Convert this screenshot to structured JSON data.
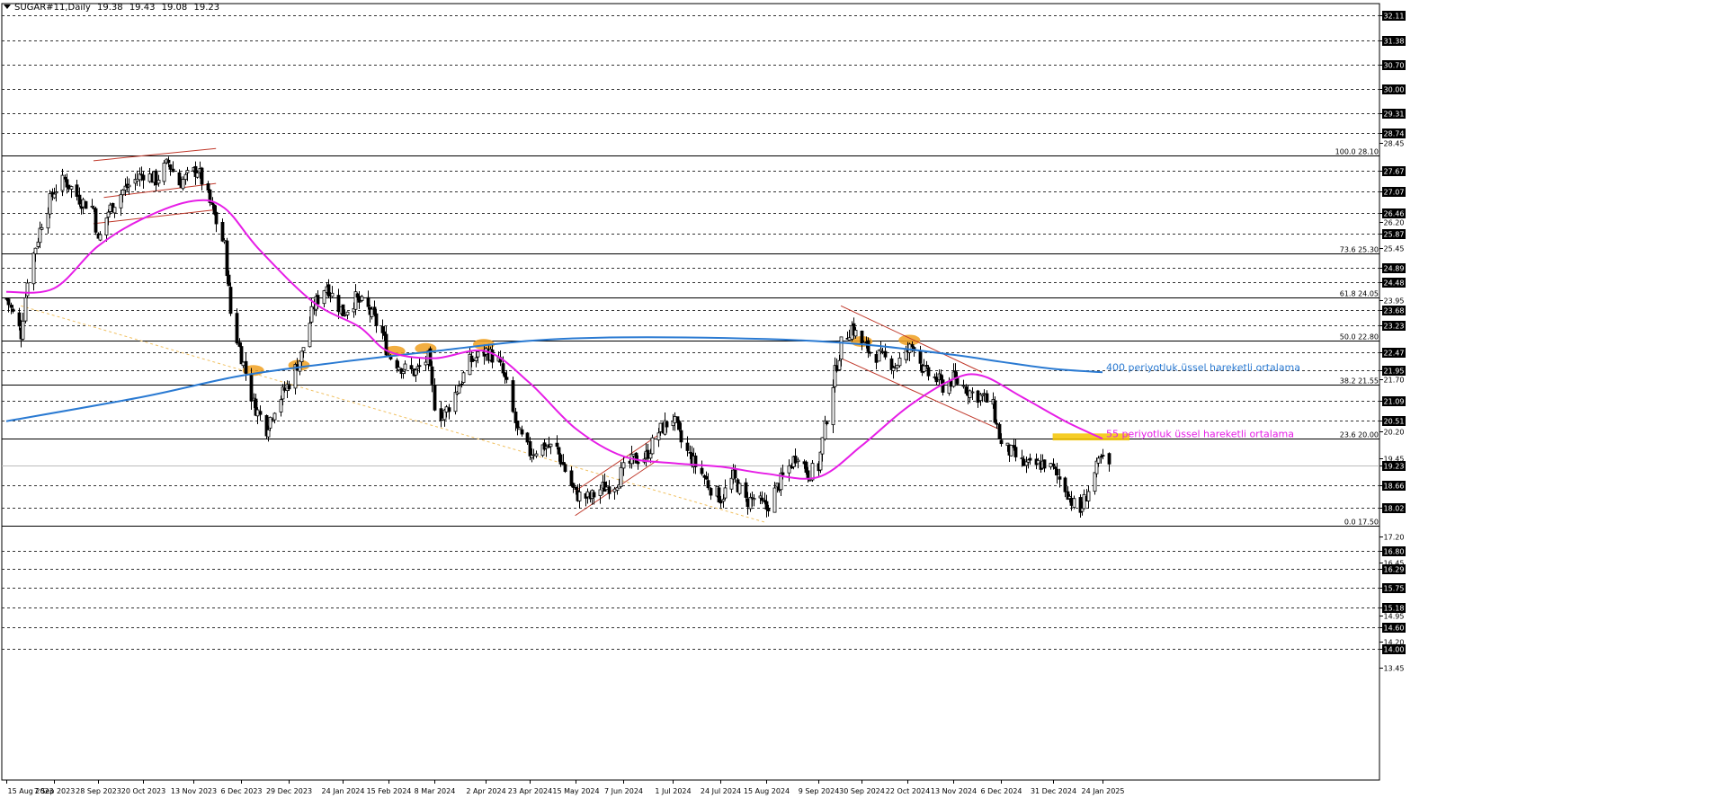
{
  "header": {
    "symbol": "SUGAR#11,Daily",
    "open": "19.38",
    "high": "19.43",
    "low": "19.08",
    "close": "19.23"
  },
  "chart_data": {
    "type": "candlestick",
    "timeframe": "Daily",
    "ylim": [
      13.45,
      32.25
    ],
    "grid": false,
    "x_ticks": [
      "15 Aug 2023",
      "7 Sep 2023",
      "28 Sep 2023",
      "20 Oct 2023",
      "13 Nov 2023",
      "6 Dec 2023",
      "29 Dec 2023",
      "24 Jan 2024",
      "15 Feb 2024",
      "8 Mar 2024",
      "2 Apr 2024",
      "23 Apr 2024",
      "15 May 2024",
      "7 Jun 2024",
      "1 Jul 2024",
      "24 Jul 2024",
      "15 Aug 2024",
      "9 Sep 2024",
      "30 Sep 2024",
      "22 Oct 2024",
      "13 Nov 2024",
      "6 Dec 2024",
      "31 Dec 2024",
      "24 Jan 2025"
    ],
    "y_ticks": [
      "32.11",
      "31.38",
      "30.70",
      "30.00",
      "29.31",
      "28.74",
      "28.45",
      "27.67",
      "27.07",
      "26.46",
      "26.20",
      "25.87",
      "25.45",
      "24.89",
      "24.48",
      "23.95",
      "23.68",
      "23.23",
      "22.47",
      "21.95",
      "21.70",
      "21.09",
      "20.51",
      "20.20",
      "19.45",
      "19.23",
      "18.66",
      "18.02",
      "17.20",
      "16.80",
      "16.45",
      "16.29",
      "15.75",
      "15.18",
      "14.95",
      "14.60",
      "14.20",
      "14.00",
      "13.45"
    ],
    "boxed_levels": [
      32.11,
      31.38,
      30.7,
      30.0,
      29.31,
      28.74,
      27.67,
      27.07,
      26.46,
      25.87,
      24.89,
      24.48,
      23.68,
      23.23,
      22.47,
      21.95,
      21.09,
      20.51,
      19.23,
      18.66,
      18.02,
      16.8,
      16.29,
      15.75,
      15.18,
      14.6,
      14.0
    ],
    "plain_ticks": [
      28.45,
      26.2,
      25.45,
      23.95,
      21.7,
      20.2,
      19.45,
      17.2,
      16.45,
      14.95,
      14.2,
      13.45
    ],
    "fibonacci": [
      {
        "label": "100.0 28.10",
        "value": 28.1
      },
      {
        "label": "73.6 25.30",
        "value": 25.3
      },
      {
        "label": "61.8 24.05",
        "value": 24.05
      },
      {
        "label": "50.0 22.80",
        "value": 22.8
      },
      {
        "label": "38.2 21.55",
        "value": 21.55
      },
      {
        "label": "23.6 20.00",
        "value": 20.0
      },
      {
        "label": "0.0 17.50",
        "value": 17.5
      }
    ],
    "price_path": [
      [
        "2023-08-15",
        24.0
      ],
      [
        "2023-08-22",
        23.0
      ],
      [
        "2023-08-25",
        24.6
      ],
      [
        "2023-09-01",
        26.2
      ],
      [
        "2023-09-07",
        27.1
      ],
      [
        "2023-09-12",
        27.4
      ],
      [
        "2023-09-20",
        26.8
      ],
      [
        "2023-09-26",
        26.6
      ],
      [
        "2023-09-28",
        25.6
      ],
      [
        "2023-10-03",
        26.5
      ],
      [
        "2023-10-10",
        27.1
      ],
      [
        "2023-10-20",
        27.6
      ],
      [
        "2023-10-26",
        27.4
      ],
      [
        "2023-11-01",
        27.9
      ],
      [
        "2023-11-06",
        27.3
      ],
      [
        "2023-11-10",
        27.5
      ],
      [
        "2023-11-15",
        27.7
      ],
      [
        "2023-11-20",
        26.9
      ],
      [
        "2023-11-24",
        26.2
      ],
      [
        "2023-11-28",
        25.5
      ],
      [
        "2023-12-01",
        23.6
      ],
      [
        "2023-12-05",
        22.6
      ],
      [
        "2023-12-08",
        21.9
      ],
      [
        "2023-12-12",
        21.0
      ],
      [
        "2023-12-18",
        20.3
      ],
      [
        "2023-12-22",
        20.9
      ],
      [
        "2023-12-29",
        21.6
      ],
      [
        "2024-01-04",
        22.4
      ],
      [
        "2024-01-10",
        23.8
      ],
      [
        "2024-01-16",
        24.4
      ],
      [
        "2024-01-24",
        23.6
      ],
      [
        "2024-01-30",
        24.0
      ],
      [
        "2024-02-05",
        23.7
      ],
      [
        "2024-02-12",
        23.0
      ],
      [
        "2024-02-15",
        22.4
      ],
      [
        "2024-02-22",
        22.0
      ],
      [
        "2024-02-28",
        21.9
      ],
      [
        "2024-03-05",
        22.3
      ],
      [
        "2024-03-08",
        21.0
      ],
      [
        "2024-03-12",
        20.6
      ],
      [
        "2024-03-18",
        21.3
      ],
      [
        "2024-03-25",
        22.2
      ],
      [
        "2024-04-02",
        22.5
      ],
      [
        "2024-04-08",
        22.2
      ],
      [
        "2024-04-12",
        21.5
      ],
      [
        "2024-04-17",
        20.2
      ],
      [
        "2024-04-23",
        19.6
      ],
      [
        "2024-04-30",
        19.8
      ],
      [
        "2024-05-06",
        19.7
      ],
      [
        "2024-05-10",
        19.1
      ],
      [
        "2024-05-15",
        18.4
      ],
      [
        "2024-05-22",
        18.3
      ],
      [
        "2024-05-28",
        18.6
      ],
      [
        "2024-06-03",
        18.7
      ],
      [
        "2024-06-07",
        19.1
      ],
      [
        "2024-06-12",
        19.4
      ],
      [
        "2024-06-18",
        19.5
      ],
      [
        "2024-06-24",
        20.2
      ],
      [
        "2024-07-01",
        20.6
      ],
      [
        "2024-07-05",
        19.9
      ],
      [
        "2024-07-10",
        19.4
      ],
      [
        "2024-07-15",
        19.0
      ],
      [
        "2024-07-19",
        18.6
      ],
      [
        "2024-07-24",
        18.3
      ],
      [
        "2024-07-30",
        18.9
      ],
      [
        "2024-08-05",
        18.2
      ],
      [
        "2024-08-09",
        18.3
      ],
      [
        "2024-08-15",
        18.0
      ],
      [
        "2024-08-20",
        18.6
      ],
      [
        "2024-08-26",
        19.2
      ],
      [
        "2024-08-30",
        19.6
      ],
      [
        "2024-09-04",
        19.0
      ],
      [
        "2024-09-09",
        19.2
      ],
      [
        "2024-09-12",
        20.3
      ],
      [
        "2024-09-16",
        21.6
      ],
      [
        "2024-09-20",
        22.7
      ],
      [
        "2024-09-25",
        23.2
      ],
      [
        "2024-09-30",
        22.7
      ],
      [
        "2024-10-04",
        22.5
      ],
      [
        "2024-10-10",
        22.3
      ],
      [
        "2024-10-16",
        22.1
      ],
      [
        "2024-10-22",
        22.5
      ],
      [
        "2024-10-25",
        22.7
      ],
      [
        "2024-10-30",
        21.9
      ],
      [
        "2024-11-05",
        21.7
      ],
      [
        "2024-11-08",
        21.5
      ],
      [
        "2024-11-13",
        21.7
      ],
      [
        "2024-11-18",
        21.5
      ],
      [
        "2024-11-22",
        21.3
      ],
      [
        "2024-11-27",
        21.2
      ],
      [
        "2024-12-02",
        20.9
      ],
      [
        "2024-12-06",
        19.8
      ],
      [
        "2024-12-11",
        19.6
      ],
      [
        "2024-12-16",
        19.3
      ],
      [
        "2024-12-20",
        19.2
      ],
      [
        "2024-12-27",
        19.3
      ],
      [
        "2024-12-31",
        19.1
      ],
      [
        "2025-01-06",
        18.6
      ],
      [
        "2025-01-10",
        18.1
      ],
      [
        "2025-01-13",
        17.9
      ],
      [
        "2025-01-16",
        18.4
      ],
      [
        "2025-01-20",
        19.0
      ],
      [
        "2025-01-23",
        19.4
      ],
      [
        "2025-01-27",
        19.23
      ]
    ],
    "moving_averages": [
      {
        "name": "400 periyotluk üssel hareketli ortalama",
        "color": "#2a7ad2",
        "path": [
          [
            "2023-08-15",
            20.5
          ],
          [
            "2023-10-20",
            21.2
          ],
          [
            "2023-12-06",
            21.8
          ],
          [
            "2024-01-24",
            22.2
          ],
          [
            "2024-03-08",
            22.5
          ],
          [
            "2024-04-23",
            22.8
          ],
          [
            "2024-06-07",
            22.9
          ],
          [
            "2024-08-15",
            22.85
          ],
          [
            "2024-09-30",
            22.7
          ],
          [
            "2024-11-13",
            22.4
          ],
          [
            "2024-12-06",
            22.2
          ],
          [
            "2024-12-31",
            22.0
          ],
          [
            "2025-01-24",
            21.9
          ]
        ]
      },
      {
        "name": "55 periyotluk üssel hareketli ortalama",
        "color": "#e61ee6",
        "path": [
          [
            "2023-08-15",
            24.2
          ],
          [
            "2023-09-07",
            24.3
          ],
          [
            "2023-09-28",
            25.5
          ],
          [
            "2023-10-20",
            26.3
          ],
          [
            "2023-11-13",
            26.8
          ],
          [
            "2023-11-28",
            26.6
          ],
          [
            "2023-12-15",
            25.4
          ],
          [
            "2024-01-10",
            23.9
          ],
          [
            "2024-02-01",
            23.2
          ],
          [
            "2024-02-15",
            22.5
          ],
          [
            "2024-03-08",
            22.3
          ],
          [
            "2024-04-02",
            22.5
          ],
          [
            "2024-04-23",
            21.6
          ],
          [
            "2024-05-15",
            20.3
          ],
          [
            "2024-06-07",
            19.5
          ],
          [
            "2024-07-01",
            19.3
          ],
          [
            "2024-07-24",
            19.2
          ],
          [
            "2024-08-15",
            19.0
          ],
          [
            "2024-09-09",
            18.9
          ],
          [
            "2024-09-30",
            19.8
          ],
          [
            "2024-10-22",
            20.9
          ],
          [
            "2024-11-13",
            21.7
          ],
          [
            "2024-11-27",
            21.8
          ],
          [
            "2024-12-16",
            21.2
          ],
          [
            "2025-01-06",
            20.5
          ],
          [
            "2025-01-24",
            20.0
          ]
        ]
      }
    ],
    "trend_lines": [
      {
        "color": "#c0392b",
        "from": [
          "2023-09-26",
          27.95
        ],
        "to": [
          "2023-11-24",
          28.3
        ]
      },
      {
        "color": "#c0392b",
        "from": [
          "2023-09-26",
          26.15
        ],
        "to": [
          "2023-11-24",
          26.55
        ]
      },
      {
        "color": "#c0392b",
        "from": [
          "2023-10-01",
          26.9
        ],
        "to": [
          "2023-11-24",
          27.3
        ]
      },
      {
        "color": "#c0392b",
        "from": [
          "2024-05-15",
          17.8
        ],
        "to": [
          "2024-06-24",
          19.4
        ]
      },
      {
        "color": "#c0392b",
        "from": [
          "2024-05-15",
          18.5
        ],
        "to": [
          "2024-06-24",
          20.1
        ]
      },
      {
        "color": "#c0392b",
        "from": [
          "2024-09-20",
          23.8
        ],
        "to": [
          "2024-11-27",
          21.9
        ]
      },
      {
        "color": "#c0392b",
        "from": [
          "2024-09-20",
          22.3
        ],
        "to": [
          "2024-12-06",
          20.25
        ]
      },
      {
        "color": "#f0c060",
        "from": [
          "2023-08-22",
          23.8
        ],
        "to": [
          "2024-08-15",
          17.6
        ],
        "dashed": true
      }
    ],
    "highlight_zones": [
      {
        "center": [
          "2023-12-12",
          21.95
        ]
      },
      {
        "center": [
          "2024-01-03",
          22.1
        ]
      },
      {
        "center": [
          "2024-02-18",
          22.5
        ]
      },
      {
        "center": [
          "2024-03-04",
          22.58
        ]
      },
      {
        "center": [
          "2024-04-01",
          22.7
        ]
      },
      {
        "center": [
          "2024-09-30",
          22.78
        ]
      },
      {
        "center": [
          "2024-10-23",
          22.82
        ]
      }
    ],
    "highlight_box": {
      "from": [
        "2024-12-31",
        19.95
      ],
      "to": [
        "2025-02-06",
        20.15
      ],
      "color": "#f5c400"
    },
    "annotations": [
      {
        "text": "400 periyotluk üssel hareketli ortalama",
        "color": "#2a7ad2",
        "at": [
          "2025-01-24",
          22.05
        ]
      },
      {
        "text": "55 periyotluk üssel hareketli ortalama",
        "color": "#e61ee6",
        "at": [
          "2025-01-24",
          20.15
        ]
      }
    ],
    "current_price": 19.23
  }
}
